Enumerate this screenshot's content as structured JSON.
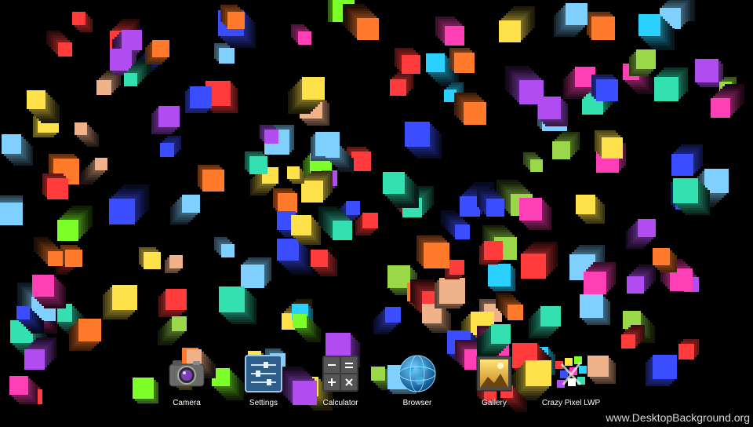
{
  "launcher": {
    "apps": [
      {
        "label": "Camera",
        "icon": "camera-icon"
      },
      {
        "label": "Settings",
        "icon": "settings-sliders-icon"
      },
      {
        "label": "Calculator",
        "icon": "calculator-icon"
      },
      {
        "label": "Browser",
        "icon": "globe-icon"
      },
      {
        "label": "Gallery",
        "icon": "gallery-picture-icon"
      },
      {
        "label": "Crazy Pixel LWP",
        "icon": "crazy-pixel-icon"
      }
    ]
  },
  "watermark": "www.DesktopBackground.org",
  "wallpaper": {
    "style": "colorful 3D pixel cubes on black",
    "colors": [
      "#ff3b3b",
      "#2ad1ff",
      "#b14cf0",
      "#7dff2a",
      "#ffe14a",
      "#ff7a2a",
      "#3a4dff",
      "#33e0b0",
      "#ff3fb6",
      "#9ad84a",
      "#7fd0ff",
      "#f0b28a"
    ]
  }
}
